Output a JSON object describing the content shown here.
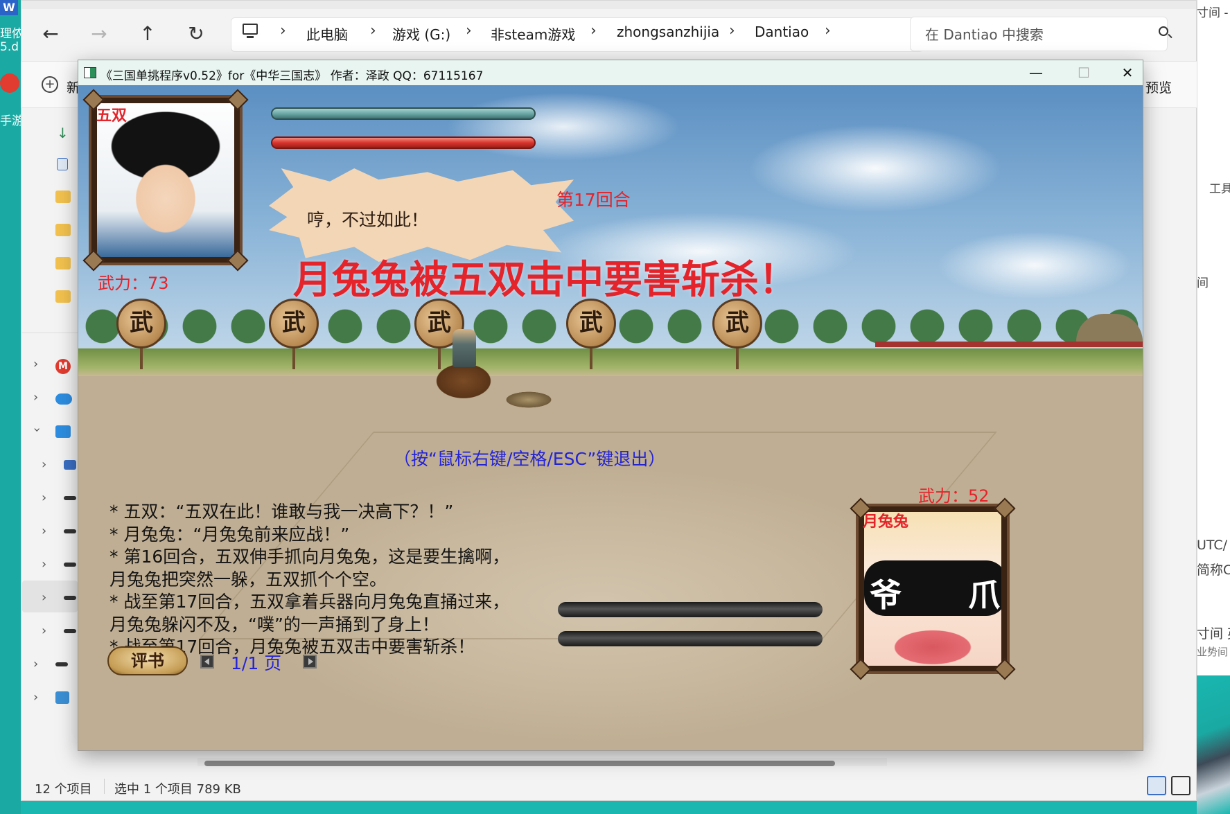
{
  "desktop": {
    "icon_text_1": "理侬",
    "icon_text_2": "5.d",
    "icon_text_3": "手游",
    "word_icon": "W"
  },
  "explorer": {
    "breadcrumbs": [
      "此电脑",
      "游戏 (G:)",
      "非steam游戏",
      "zhongsanzhijia",
      "Dantiao"
    ],
    "search_placeholder": "在 Dantiao 中搜索",
    "new_label": "新",
    "preview_label": "预览",
    "status_items": "12 个项目",
    "status_selected": "选中 1 个项目  789 KB",
    "right_pane": {
      "top": "寸间 - 扌",
      "tools": "工具",
      "mid": "间",
      "utc": "UTC/",
      "abbr": "简称C",
      "time_en": "寸间 英",
      "partial": "业势间"
    }
  },
  "game": {
    "title": "《三国单挑程序v0.52》for《中华三国志》 作者：泽政    QQ：67115167",
    "controls": {
      "minimize": "—",
      "maximize": "☐",
      "close": "✕"
    },
    "player1": {
      "name": "五双",
      "power": "武力：73"
    },
    "player2": {
      "name": "月兔兔",
      "power": "武力：52"
    },
    "speech": "哼，不过如此！",
    "round": "第17回合",
    "headline": "月兔兔被五双击中要害斩杀！",
    "drum_char": "武",
    "exit_hint": "（按“鼠标右键/空格/ESC”键退出）",
    "log": [
      "* 五双：“五双在此！谁敢与我一决高下？！”",
      "* 月兔兔：“月兔兔前来应战！”",
      "* 第16回合，五双伸手抓向月兔兔，这是要生擒啊，",
      "月兔兔把突然一躲，五双抓个个空。",
      "* 战至第17回合，五双拿着兵器向月兔兔直捅过来，",
      "月兔兔躲闪不及，“噗”的一声捅到了身上！",
      "* 战至第17回合，月兔兔被五双击中要害斩杀！"
    ],
    "pingshu_label": "评书",
    "page_text": "1/1  页",
    "portrait2_chars": {
      "left": "爷",
      "right": "爪"
    },
    "colors": {
      "hp_teal": "#6aa8a6",
      "hp_red": "#d9342c",
      "text_red": "#e4232a",
      "text_blue": "#2323d6"
    }
  }
}
